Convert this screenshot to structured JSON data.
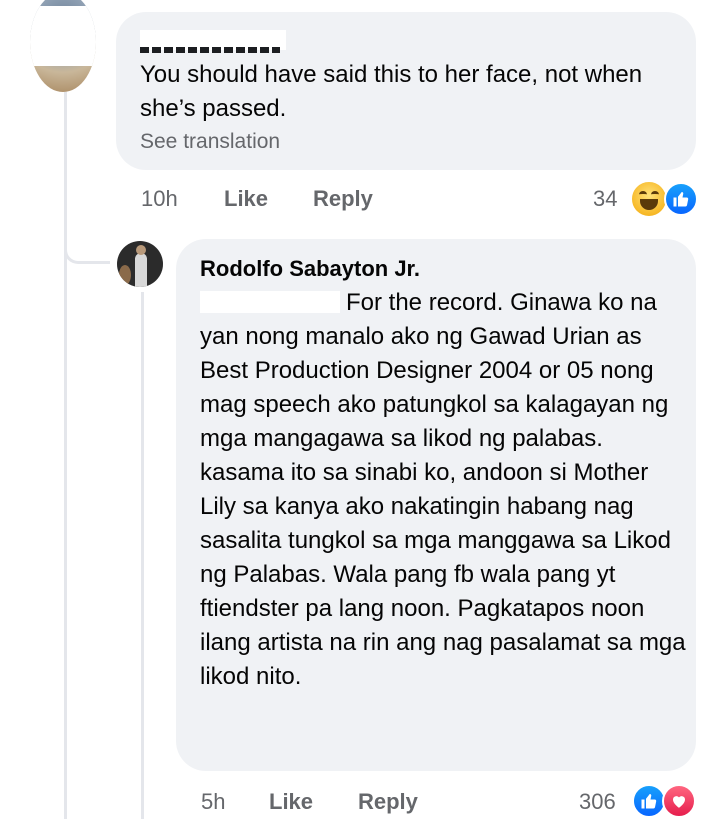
{
  "comment_1": {
    "text": "You should have said this to her face, not when she’s passed.",
    "see_translation": "See translation",
    "time": "10h",
    "like_label": "Like",
    "reply_label": "Reply",
    "reaction_count": "34",
    "reactions": [
      "haha-icon",
      "like-icon"
    ]
  },
  "comment_2": {
    "author": "Rodolfo Sabayton Jr.",
    "text": "For the record. Ginawa ko na yan nong manalo ako ng Gawad Urian as Best Production Designer 2004  or 05 nong mag speech ako patungkol sa kalagayan ng mga mangagawa sa likod ng palabas. kasama ito sa sinabi ko, andoon si Mother Lily sa kanya ako nakatingin habang nag sasalita  tungkol sa mga manggawa sa Likod ng Palabas. Wala pang fb wala pang yt ftiendster pa lang noon. Pagkatapos noon ilang artista na rin ang nag pasalamat sa mga likod nito.",
    "time": "5h",
    "like_label": "Like",
    "reply_label": "Reply",
    "reaction_count": "306",
    "reactions": [
      "like-icon",
      "love-icon"
    ]
  },
  "colors": {
    "bubble_bg": "#f0f2f5",
    "meta_text": "#65676b",
    "like_blue": "#0866ff",
    "love_red": "#e61e4d",
    "haha_yellow": "#f7b928"
  }
}
